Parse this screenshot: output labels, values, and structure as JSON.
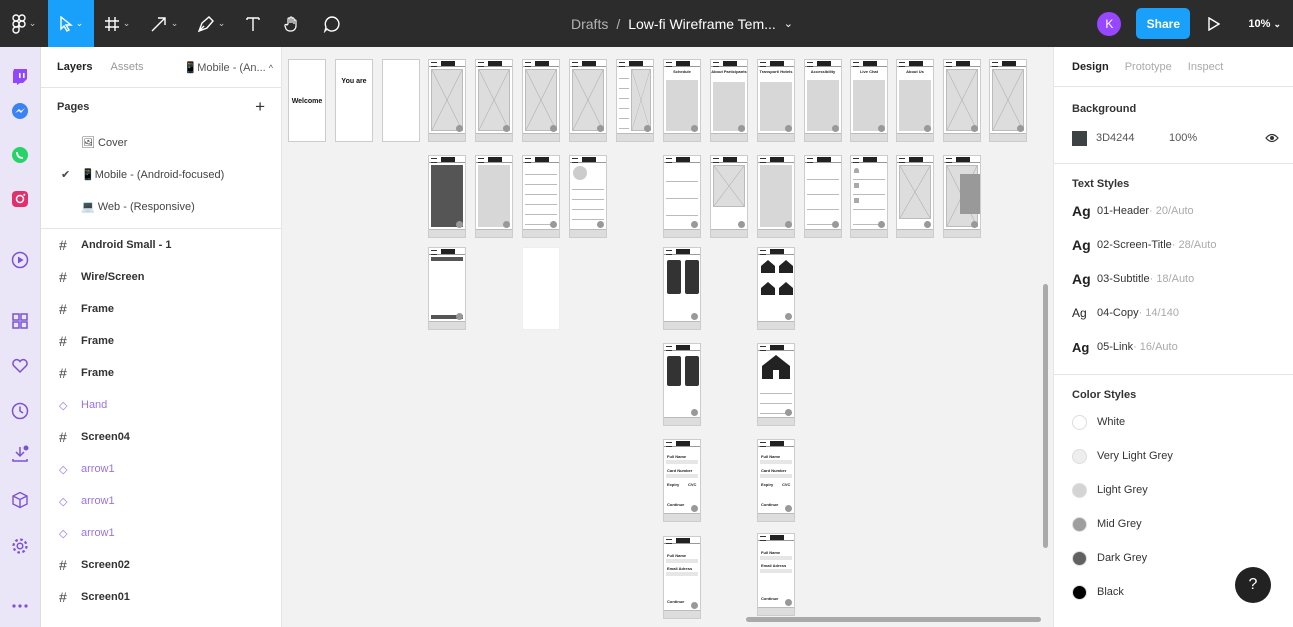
{
  "topbar": {
    "breadcrumb_parent": "Drafts",
    "separator": "/",
    "file_name": "Low-fi Wireframe Tem...",
    "avatar_initial": "K",
    "share_label": "Share",
    "zoom": "10%"
  },
  "left_panel": {
    "tab_layers": "Layers",
    "tab_assets": "Assets",
    "page_selector": "📱Mobile - (An...",
    "pages_header": "Pages",
    "add_symbol": "+",
    "pages": [
      {
        "label": "🖼 Cover"
      },
      {
        "label": "📱Mobile - (Android-focused)",
        "check": "✔"
      },
      {
        "label": "💻 Web - (Responsive)"
      }
    ],
    "layers": [
      {
        "label": "Android Small - 1"
      },
      {
        "label": "Wire/Screen"
      },
      {
        "label": "Frame"
      },
      {
        "label": "Frame"
      },
      {
        "label": "Frame"
      },
      {
        "label": "Hand"
      },
      {
        "label": "Screen04"
      },
      {
        "label": "arrow1"
      },
      {
        "label": "arrow1"
      },
      {
        "label": "arrow1"
      },
      {
        "label": "Screen02"
      },
      {
        "label": "Screen01"
      }
    ]
  },
  "canvas": {
    "frame_welcome": "Welcome",
    "frame_you_are": "You are",
    "titles": [
      "Schedule",
      "About Participants",
      "Transport/ Hotels",
      "Accessibility",
      "Live Chat",
      "About Us"
    ],
    "form_labels": {
      "full_name": "Full Name",
      "card_number": "Card Number",
      "expiry": "Expiry",
      "cvc": "CVC",
      "continue": "Continue",
      "email": "Email Adress"
    }
  },
  "right_panel": {
    "tab_design": "Design",
    "tab_prototype": "Prototype",
    "tab_inspect": "Inspect",
    "background_title": "Background",
    "background_hex": "3D4244",
    "background_opacity": "100%",
    "text_styles_title": "Text Styles",
    "text_styles": [
      {
        "ag": "Ag",
        "name": "01-Header",
        "meta": " · 20/Auto"
      },
      {
        "ag": "Ag",
        "name": "02-Screen-Title",
        "meta": " · 28/Auto"
      },
      {
        "ag": "Ag",
        "name": "03-Subtitle",
        "meta": " · 18/Auto"
      },
      {
        "ag": "Ag",
        "name": "04-Copy",
        "meta": " · 14/140"
      },
      {
        "ag": "Ag",
        "name": "05-Link",
        "meta": " · 16/Auto"
      }
    ],
    "color_styles_title": "Color Styles",
    "color_styles": [
      {
        "name": "White",
        "color": "#ffffff"
      },
      {
        "name": "Very Light Grey",
        "color": "#eeeeee"
      },
      {
        "name": "Light Grey",
        "color": "#d4d4d4"
      },
      {
        "name": "Mid Grey",
        "color": "#9e9e9e"
      },
      {
        "name": "Dark Grey",
        "color": "#616161"
      },
      {
        "name": "Black",
        "color": "#000000"
      }
    ],
    "help": "?"
  },
  "colors": {
    "topbar": "#2c2c2c",
    "accent": "#18a0fb",
    "avatar": "#9747ff",
    "component": "#9b71e8"
  }
}
